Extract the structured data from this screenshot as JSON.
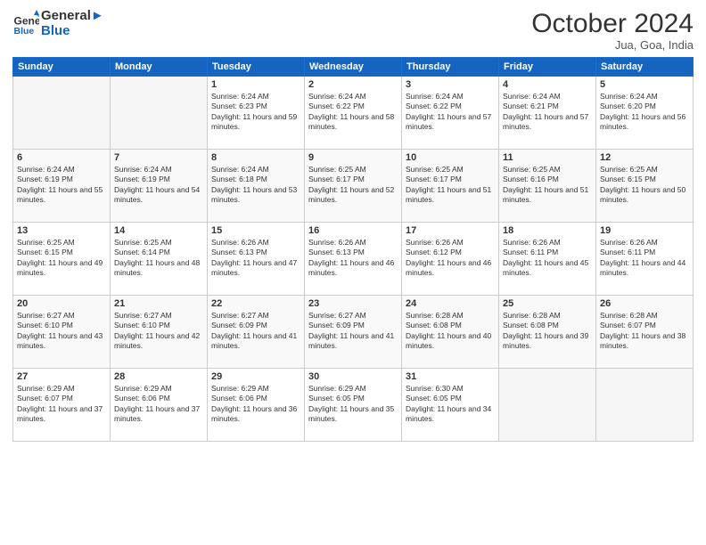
{
  "header": {
    "logo_line1": "General",
    "logo_line2": "Blue",
    "month": "October 2024",
    "location": "Jua, Goa, India"
  },
  "days_of_week": [
    "Sunday",
    "Monday",
    "Tuesday",
    "Wednesday",
    "Thursday",
    "Friday",
    "Saturday"
  ],
  "weeks": [
    [
      {
        "day": "",
        "sunrise": "",
        "sunset": "",
        "daylight": ""
      },
      {
        "day": "",
        "sunrise": "",
        "sunset": "",
        "daylight": ""
      },
      {
        "day": "1",
        "sunrise": "Sunrise: 6:24 AM",
        "sunset": "Sunset: 6:23 PM",
        "daylight": "Daylight: 11 hours and 59 minutes."
      },
      {
        "day": "2",
        "sunrise": "Sunrise: 6:24 AM",
        "sunset": "Sunset: 6:22 PM",
        "daylight": "Daylight: 11 hours and 58 minutes."
      },
      {
        "day": "3",
        "sunrise": "Sunrise: 6:24 AM",
        "sunset": "Sunset: 6:22 PM",
        "daylight": "Daylight: 11 hours and 57 minutes."
      },
      {
        "day": "4",
        "sunrise": "Sunrise: 6:24 AM",
        "sunset": "Sunset: 6:21 PM",
        "daylight": "Daylight: 11 hours and 57 minutes."
      },
      {
        "day": "5",
        "sunrise": "Sunrise: 6:24 AM",
        "sunset": "Sunset: 6:20 PM",
        "daylight": "Daylight: 11 hours and 56 minutes."
      }
    ],
    [
      {
        "day": "6",
        "sunrise": "Sunrise: 6:24 AM",
        "sunset": "Sunset: 6:19 PM",
        "daylight": "Daylight: 11 hours and 55 minutes."
      },
      {
        "day": "7",
        "sunrise": "Sunrise: 6:24 AM",
        "sunset": "Sunset: 6:19 PM",
        "daylight": "Daylight: 11 hours and 54 minutes."
      },
      {
        "day": "8",
        "sunrise": "Sunrise: 6:24 AM",
        "sunset": "Sunset: 6:18 PM",
        "daylight": "Daylight: 11 hours and 53 minutes."
      },
      {
        "day": "9",
        "sunrise": "Sunrise: 6:25 AM",
        "sunset": "Sunset: 6:17 PM",
        "daylight": "Daylight: 11 hours and 52 minutes."
      },
      {
        "day": "10",
        "sunrise": "Sunrise: 6:25 AM",
        "sunset": "Sunset: 6:17 PM",
        "daylight": "Daylight: 11 hours and 51 minutes."
      },
      {
        "day": "11",
        "sunrise": "Sunrise: 6:25 AM",
        "sunset": "Sunset: 6:16 PM",
        "daylight": "Daylight: 11 hours and 51 minutes."
      },
      {
        "day": "12",
        "sunrise": "Sunrise: 6:25 AM",
        "sunset": "Sunset: 6:15 PM",
        "daylight": "Daylight: 11 hours and 50 minutes."
      }
    ],
    [
      {
        "day": "13",
        "sunrise": "Sunrise: 6:25 AM",
        "sunset": "Sunset: 6:15 PM",
        "daylight": "Daylight: 11 hours and 49 minutes."
      },
      {
        "day": "14",
        "sunrise": "Sunrise: 6:25 AM",
        "sunset": "Sunset: 6:14 PM",
        "daylight": "Daylight: 11 hours and 48 minutes."
      },
      {
        "day": "15",
        "sunrise": "Sunrise: 6:26 AM",
        "sunset": "Sunset: 6:13 PM",
        "daylight": "Daylight: 11 hours and 47 minutes."
      },
      {
        "day": "16",
        "sunrise": "Sunrise: 6:26 AM",
        "sunset": "Sunset: 6:13 PM",
        "daylight": "Daylight: 11 hours and 46 minutes."
      },
      {
        "day": "17",
        "sunrise": "Sunrise: 6:26 AM",
        "sunset": "Sunset: 6:12 PM",
        "daylight": "Daylight: 11 hours and 46 minutes."
      },
      {
        "day": "18",
        "sunrise": "Sunrise: 6:26 AM",
        "sunset": "Sunset: 6:11 PM",
        "daylight": "Daylight: 11 hours and 45 minutes."
      },
      {
        "day": "19",
        "sunrise": "Sunrise: 6:26 AM",
        "sunset": "Sunset: 6:11 PM",
        "daylight": "Daylight: 11 hours and 44 minutes."
      }
    ],
    [
      {
        "day": "20",
        "sunrise": "Sunrise: 6:27 AM",
        "sunset": "Sunset: 6:10 PM",
        "daylight": "Daylight: 11 hours and 43 minutes."
      },
      {
        "day": "21",
        "sunrise": "Sunrise: 6:27 AM",
        "sunset": "Sunset: 6:10 PM",
        "daylight": "Daylight: 11 hours and 42 minutes."
      },
      {
        "day": "22",
        "sunrise": "Sunrise: 6:27 AM",
        "sunset": "Sunset: 6:09 PM",
        "daylight": "Daylight: 11 hours and 41 minutes."
      },
      {
        "day": "23",
        "sunrise": "Sunrise: 6:27 AM",
        "sunset": "Sunset: 6:09 PM",
        "daylight": "Daylight: 11 hours and 41 minutes."
      },
      {
        "day": "24",
        "sunrise": "Sunrise: 6:28 AM",
        "sunset": "Sunset: 6:08 PM",
        "daylight": "Daylight: 11 hours and 40 minutes."
      },
      {
        "day": "25",
        "sunrise": "Sunrise: 6:28 AM",
        "sunset": "Sunset: 6:08 PM",
        "daylight": "Daylight: 11 hours and 39 minutes."
      },
      {
        "day": "26",
        "sunrise": "Sunrise: 6:28 AM",
        "sunset": "Sunset: 6:07 PM",
        "daylight": "Daylight: 11 hours and 38 minutes."
      }
    ],
    [
      {
        "day": "27",
        "sunrise": "Sunrise: 6:29 AM",
        "sunset": "Sunset: 6:07 PM",
        "daylight": "Daylight: 11 hours and 37 minutes."
      },
      {
        "day": "28",
        "sunrise": "Sunrise: 6:29 AM",
        "sunset": "Sunset: 6:06 PM",
        "daylight": "Daylight: 11 hours and 37 minutes."
      },
      {
        "day": "29",
        "sunrise": "Sunrise: 6:29 AM",
        "sunset": "Sunset: 6:06 PM",
        "daylight": "Daylight: 11 hours and 36 minutes."
      },
      {
        "day": "30",
        "sunrise": "Sunrise: 6:29 AM",
        "sunset": "Sunset: 6:05 PM",
        "daylight": "Daylight: 11 hours and 35 minutes."
      },
      {
        "day": "31",
        "sunrise": "Sunrise: 6:30 AM",
        "sunset": "Sunset: 6:05 PM",
        "daylight": "Daylight: 11 hours and 34 minutes."
      },
      {
        "day": "",
        "sunrise": "",
        "sunset": "",
        "daylight": ""
      },
      {
        "day": "",
        "sunrise": "",
        "sunset": "",
        "daylight": ""
      }
    ]
  ]
}
